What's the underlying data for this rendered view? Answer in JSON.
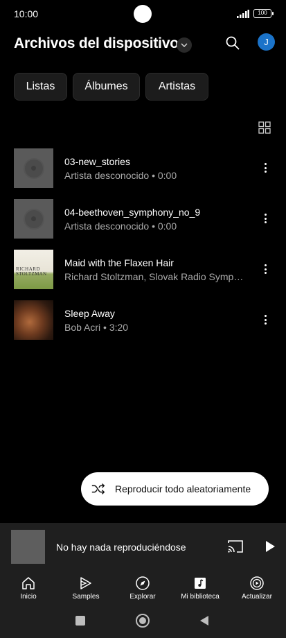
{
  "status_bar": {
    "time": "10:00",
    "battery": "100"
  },
  "header": {
    "title": "Archivos del dispositivo",
    "avatar_initial": "J"
  },
  "chips": [
    {
      "label": "Listas"
    },
    {
      "label": "Álbumes"
    },
    {
      "label": "Artistas"
    }
  ],
  "tracks": [
    {
      "title": "03-new_stories",
      "subtitle": "Artista desconocido • 0:00",
      "art": "generic-disc"
    },
    {
      "title": "04-beethoven_symphony_no_9",
      "subtitle": "Artista desconocido • 0:00",
      "art": "generic-disc"
    },
    {
      "title": "Maid with the Flaxen Hair",
      "subtitle": "Richard Stoltzman, Slovak Radio Symph…",
      "art": "album-cover",
      "cover_text": [
        "RICHARD",
        "STOLTZMAN"
      ]
    },
    {
      "title": "Sleep Away",
      "subtitle": "Bob Acri • 3:20",
      "art": "album-cover"
    }
  ],
  "shuffle": {
    "label": "Reproducir todo aleatoriamente"
  },
  "mini_player": {
    "label": "No hay nada reproduciéndose"
  },
  "bottom_nav": [
    {
      "label": "Inicio",
      "icon": "home-icon"
    },
    {
      "label": "Samples",
      "icon": "samples-icon"
    },
    {
      "label": "Explorar",
      "icon": "compass-icon"
    },
    {
      "label": "Mi biblioteca",
      "icon": "library-icon"
    },
    {
      "label": "Actualizar",
      "icon": "upgrade-icon"
    }
  ],
  "colors": {
    "background": "#000000",
    "surface": "#1f1f1f",
    "avatar": "#1b73c9",
    "secondary_text": "#aaaaaa"
  }
}
